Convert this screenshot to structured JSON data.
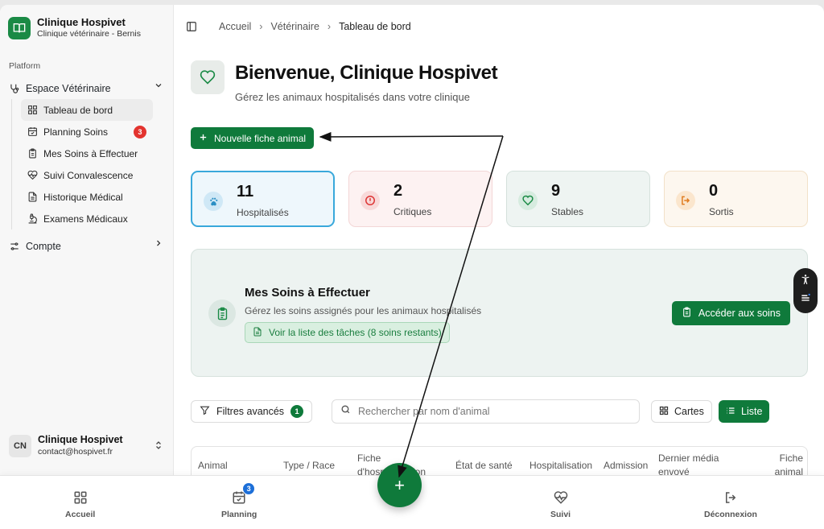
{
  "brand": {
    "title": "Clinique Hospivet",
    "subtitle": "Clinique vétérinaire - Bernis"
  },
  "sidebar": {
    "section": "Platform",
    "group": "Espace Vétérinaire",
    "items": [
      {
        "label": "Tableau de bord",
        "icon": "grid-icon",
        "active": true
      },
      {
        "label": "Planning Soins",
        "icon": "calendar-check-icon",
        "badge": "3"
      },
      {
        "label": "Mes Soins à Effectuer",
        "icon": "clipboard-icon"
      },
      {
        "label": "Suivi Convalescence",
        "icon": "heart-pulse-icon"
      },
      {
        "label": "Historique Médical",
        "icon": "file-text-icon"
      },
      {
        "label": "Examens Médicaux",
        "icon": "microscope-icon"
      }
    ],
    "account": "Compte"
  },
  "user": {
    "initials": "CN",
    "name": "Clinique Hospivet",
    "email": "contact@hospivet.fr"
  },
  "breadcrumb": [
    "Accueil",
    "Vétérinaire",
    "Tableau de bord"
  ],
  "hero": {
    "title": "Bienvenue, Clinique Hospivet",
    "subtitle": "Gérez les animaux hospitalisés dans votre clinique"
  },
  "new_button": "Nouvelle fiche animal",
  "stats": [
    {
      "value": "11",
      "label": "Hospitalisés",
      "color": "#39a8db"
    },
    {
      "value": "2",
      "label": "Critiques",
      "color": "#dd3333"
    },
    {
      "value": "9",
      "label": "Stables",
      "color": "#1a8a45"
    },
    {
      "value": "0",
      "label": "Sortis",
      "color": "#e07a1c"
    }
  ],
  "soins": {
    "title": "Mes Soins à Effectuer",
    "subtitle": "Gérez les soins assignés pour les animaux hospitalisés",
    "link": "Voir la liste des tâches (8 soins restants)",
    "button": "Accéder aux soins"
  },
  "toolbar": {
    "filters": "Filtres avancés",
    "filters_count": "1",
    "search_placeholder": "Rechercher par nom d'animal",
    "cards": "Cartes",
    "list": "Liste"
  },
  "table": {
    "columns": [
      "Animal",
      "Type / Race",
      "Fiche d'hospitalisation",
      "État de santé",
      "Hospitalisation",
      "Admission",
      "Dernier média envoyé",
      "Fiche animal"
    ]
  },
  "bottom_nav": {
    "home": "Accueil",
    "planning": "Planning",
    "planning_badge": "3",
    "suivi": "Suivi",
    "logout": "Déconnexion",
    "fab": "+"
  },
  "colors": {
    "primary": "#0f7a3b",
    "accent_blue": "#39a8db",
    "danger": "#e3342f"
  }
}
